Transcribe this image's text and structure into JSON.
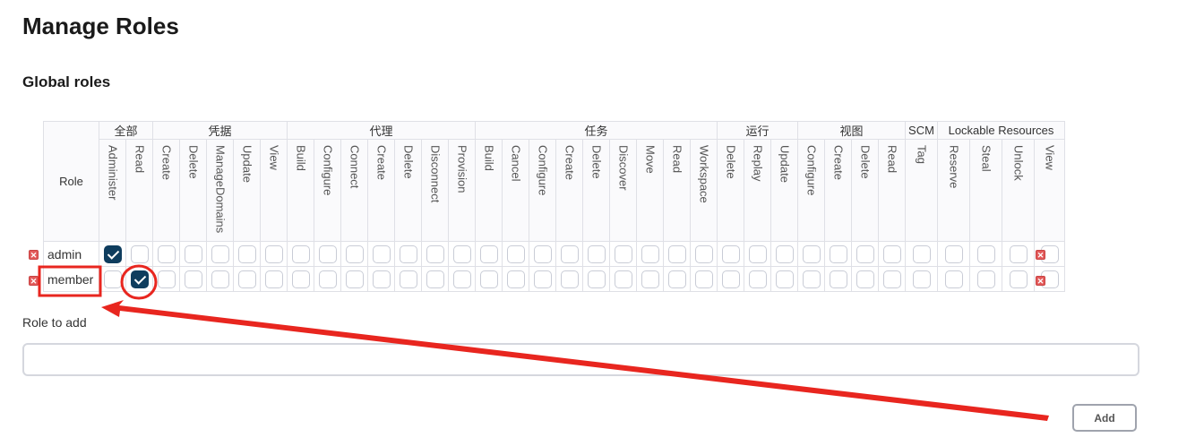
{
  "page": {
    "title": "Manage Roles",
    "subtitle": "Global roles"
  },
  "table": {
    "role_header": "Role",
    "groups": [
      {
        "label": "全部",
        "span": 2
      },
      {
        "label": "凭据",
        "span": 5
      },
      {
        "label": "代理",
        "span": 7
      },
      {
        "label": "任务",
        "span": 9
      },
      {
        "label": "运行",
        "span": 3
      },
      {
        "label": "视图",
        "span": 4
      },
      {
        "label": "SCM",
        "span": 1
      },
      {
        "label": "Lockable Resources",
        "span": 4
      }
    ],
    "permissions": [
      "Administer",
      "Read",
      "Create",
      "Delete",
      "ManageDomains",
      "Update",
      "View",
      "Build",
      "Configure",
      "Connect",
      "Create",
      "Delete",
      "Disconnect",
      "Provision",
      "Build",
      "Cancel",
      "Configure",
      "Create",
      "Delete",
      "Discover",
      "Move",
      "Read",
      "Workspace",
      "Delete",
      "Replay",
      "Update",
      "Configure",
      "Create",
      "Delete",
      "Read",
      "Tag",
      "Reserve",
      "Steal",
      "Unlock",
      "View"
    ],
    "rows": [
      {
        "name": "admin",
        "checked": [
          0
        ]
      },
      {
        "name": "member",
        "checked": [
          1
        ]
      }
    ]
  },
  "role_to_add": {
    "label": "Role to add",
    "value": "",
    "placeholder": ""
  },
  "add_button": {
    "label": "Add"
  },
  "colors": {
    "accent": "#0f3d5e",
    "annotation": "#e8261f"
  }
}
